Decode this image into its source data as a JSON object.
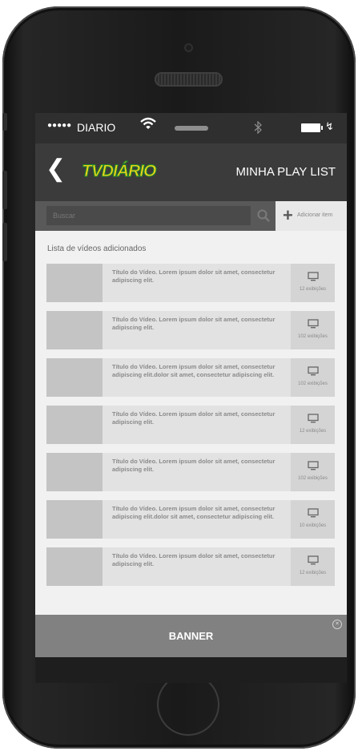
{
  "status_bar": {
    "signal_dots": "●●●●●",
    "carrier": "DIARIO",
    "wifi_icon": "wifi-icon",
    "bluetooth_icon": "bluetooth-icon",
    "battery_icon": "battery-icon",
    "charge_symbol": "↯"
  },
  "navbar": {
    "back_symbol": "❮",
    "logo_text": "TVDIÁRIO",
    "title": "MINHA PLAY LIST"
  },
  "search": {
    "placeholder": "Buscar",
    "value": ""
  },
  "add_button": {
    "symbol": "+",
    "label": "Adicionar item"
  },
  "list": {
    "title": "Lista de vídeos adicionados",
    "items": [
      {
        "text": "Título do Vídeo. Lorem ipsum dolor sit amet, consectetur adipiscing elit.",
        "views": "12 exibições"
      },
      {
        "text": "Título do Vídeo. Lorem ipsum dolor sit amet, consectetur adipiscing elit.",
        "views": "102 exibições"
      },
      {
        "text": "Título do Vídeo. Lorem ipsum dolor sit amet, consectetur adipiscing elit.dolor sit amet, consectetur adipiscing elit.",
        "views": "102 exibições"
      },
      {
        "text": "Título do Vídeo. Lorem ipsum dolor sit amet, consectetur adipiscing elit.",
        "views": "12 exibições"
      },
      {
        "text": "Título do Vídeo. Lorem ipsum dolor sit amet, consectetur adipiscing elit.",
        "views": "102 exibições"
      },
      {
        "text": "Título do Vídeo. Lorem ipsum dolor sit amet, consectetur adipiscing elit.dolor sit amet, consectetur adipiscing elit.",
        "views": "10 exibições"
      },
      {
        "text": "Título do Vídeo. Lorem ipsum dolor sit amet, consectetur adipiscing elit.",
        "views": "12 exibições"
      }
    ]
  },
  "banner": {
    "label": "BANNER",
    "close_symbol": "×"
  },
  "colors": {
    "navbar": "#3b3b3b",
    "status_bar": "#2f2f2f",
    "logo_yellow": "#f2d21a",
    "logo_green": "#1d8a2a",
    "banner": "#818181"
  }
}
